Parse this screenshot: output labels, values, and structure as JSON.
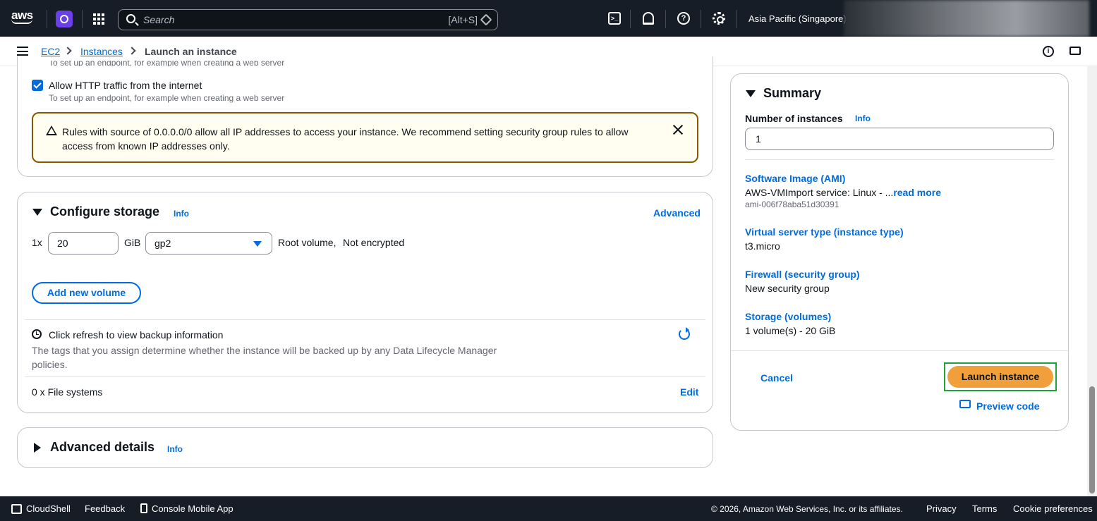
{
  "topnav": {
    "logo": "aws",
    "search_placeholder": "Search",
    "search_shortcut": "[Alt+S]",
    "region": "Asia Pacific (Singapore)"
  },
  "breadcrumb": {
    "items": [
      "EC2",
      "Instances",
      "Launch an instance"
    ]
  },
  "network": {
    "truncated_hint": "To set up an endpoint, for example when creating a web server",
    "http_checkbox_label": "Allow HTTP traffic from the internet",
    "http_checkbox_checked": true,
    "http_hint": "To set up an endpoint, for example when creating a web server",
    "alert_text": "Rules with source of 0.0.0.0/0 allow all IP addresses to access your instance. We recommend setting security group rules to allow access from known IP addresses only."
  },
  "storage": {
    "title": "Configure storage",
    "info": "Info",
    "advanced": "Advanced",
    "count_prefix": "1x",
    "size_value": "20",
    "size_unit": "GiB",
    "volume_type": "gp2",
    "root_label": "Root volume,",
    "encryption": "Not encrypted",
    "add_volume": "Add new volume",
    "backup_title": "Click refresh to view backup information",
    "backup_desc": "The tags that you assign determine whether the instance will be backed up by any Data Lifecycle Manager policies.",
    "file_systems": "0 x File systems",
    "edit": "Edit"
  },
  "advanced_details": {
    "title": "Advanced details",
    "info": "Info"
  },
  "summary": {
    "title": "Summary",
    "instances_label": "Number of instances",
    "info": "Info",
    "instances_value": "1",
    "ami_label": "Software Image (AMI)",
    "ami_value": "AWS-VMImport service: Linux - ...",
    "read_more": "read more",
    "ami_id": "ami-006f78aba51d30391",
    "type_label": "Virtual server type (instance type)",
    "type_value": "t3.micro",
    "firewall_label": "Firewall (security group)",
    "firewall_value": "New security group",
    "storage_label": "Storage (volumes)",
    "storage_value": "1 volume(s) - 20 GiB",
    "cancel": "Cancel",
    "launch": "Launch instance",
    "preview": "Preview code"
  },
  "footer": {
    "cloudshell": "CloudShell",
    "feedback": "Feedback",
    "mobile_app": "Console Mobile App",
    "copyright": "© 2026, Amazon Web Services, Inc. or its affiliates.",
    "privacy": "Privacy",
    "terms": "Terms",
    "cookies": "Cookie preferences"
  },
  "colors": {
    "nav_bg": "#161d26",
    "link": "#006ce0",
    "launch_button": "#f09f3a",
    "highlight_frame": "#1fa33a",
    "warning_border": "#855900"
  }
}
